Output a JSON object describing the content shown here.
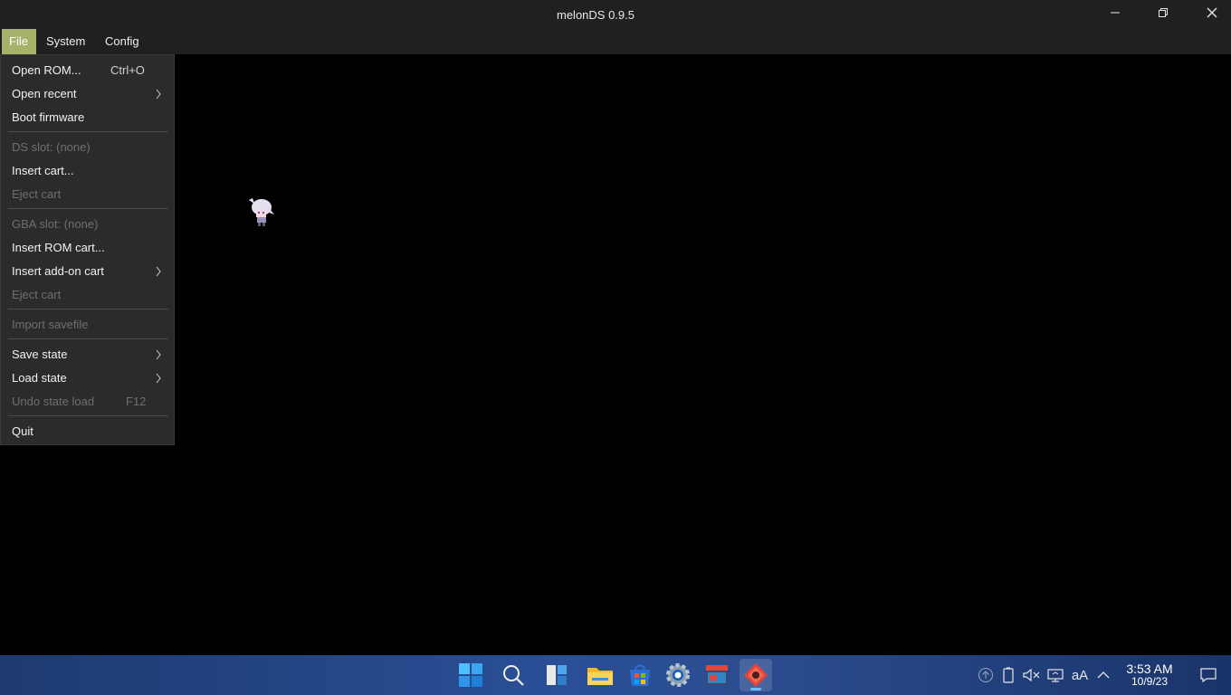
{
  "window": {
    "title": "melonDS 0.9.5",
    "controls": [
      "minimize-icon",
      "restore-icon",
      "close-icon"
    ]
  },
  "menubar": {
    "items": [
      {
        "label": "File",
        "active": true
      },
      {
        "label": "System"
      },
      {
        "label": "Config"
      }
    ]
  },
  "file_menu": {
    "items": [
      {
        "label": "Open ROM...",
        "shortcut": "Ctrl+O",
        "enabled": true
      },
      {
        "label": "Open recent",
        "submenu": true,
        "enabled": true
      },
      {
        "label": "Boot firmware",
        "enabled": true
      },
      {
        "label": "DS slot: (none)",
        "enabled": false
      },
      {
        "label": "Insert cart...",
        "enabled": true
      },
      {
        "label": "Eject cart",
        "enabled": false
      },
      {
        "label": "GBA slot: (none)",
        "enabled": false
      },
      {
        "label": "Insert ROM cart...",
        "enabled": true
      },
      {
        "label": "Insert add-on cart",
        "submenu": true,
        "enabled": true
      },
      {
        "label": "Eject cart",
        "enabled": false
      },
      {
        "label": "Import savefile",
        "enabled": false
      },
      {
        "label": "Save state",
        "submenu": true,
        "enabled": true
      },
      {
        "label": "Load state",
        "submenu": true,
        "enabled": true
      },
      {
        "label": "Undo state load",
        "shortcut": "F12",
        "enabled": false
      },
      {
        "label": "Quit",
        "enabled": true
      }
    ]
  },
  "taskbar": {
    "apps": [
      "start-icon",
      "search-icon",
      "task-view-icon",
      "file-explorer-icon",
      "store-icon",
      "settings-icon",
      "app-icon",
      "melonds-icon"
    ],
    "tray": [
      "chevron-up-icon",
      "battery-icon",
      "speaker-muted-icon",
      "display-icon",
      "font-size-icon",
      "chevron-icon"
    ],
    "font_label": "aA",
    "clock": {
      "time": "3:53 AM",
      "date": "10/9/23"
    },
    "accent": "#a6b26a"
  }
}
